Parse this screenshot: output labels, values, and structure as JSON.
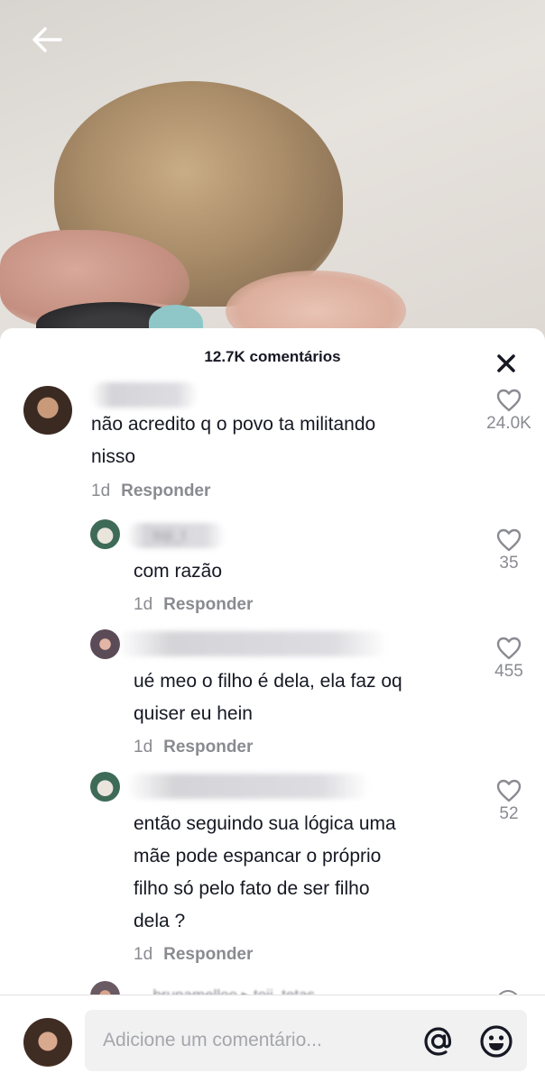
{
  "header": {
    "comment_count": "12.7K comentários"
  },
  "comments": [
    {
      "username": "",
      "text_lines": [
        "não acredito q o povo ta militando",
        "nisso"
      ],
      "age": "1d",
      "reply_label": "Responder",
      "likes": "24.0K"
    },
    {
      "username": "toji_t",
      "text_lines": [
        "com razão"
      ],
      "age": "1d",
      "reply_label": "Responder",
      "likes": "35"
    },
    {
      "username": "",
      "text_lines": [
        "ué meo o filho é dela, ela faz oq",
        "quiser eu hein"
      ],
      "age": "1d",
      "reply_label": "Responder",
      "likes": "455"
    },
    {
      "username": "",
      "text_lines": [
        "então seguindo sua lógica uma",
        "mãe pode espancar o próprio",
        "filho só pelo fato de ser filho",
        "dela ?"
      ],
      "age": "1d",
      "reply_label": "Responder",
      "likes": "52"
    }
  ],
  "partial_comment": {
    "username_line": "_brunamelloo ▸ toji_tetas"
  },
  "input": {
    "placeholder": "Adicione um comentário..."
  },
  "colors": {
    "text": "#161823",
    "muted": "#8a8b91",
    "input_bg": "#f1f1f2"
  }
}
